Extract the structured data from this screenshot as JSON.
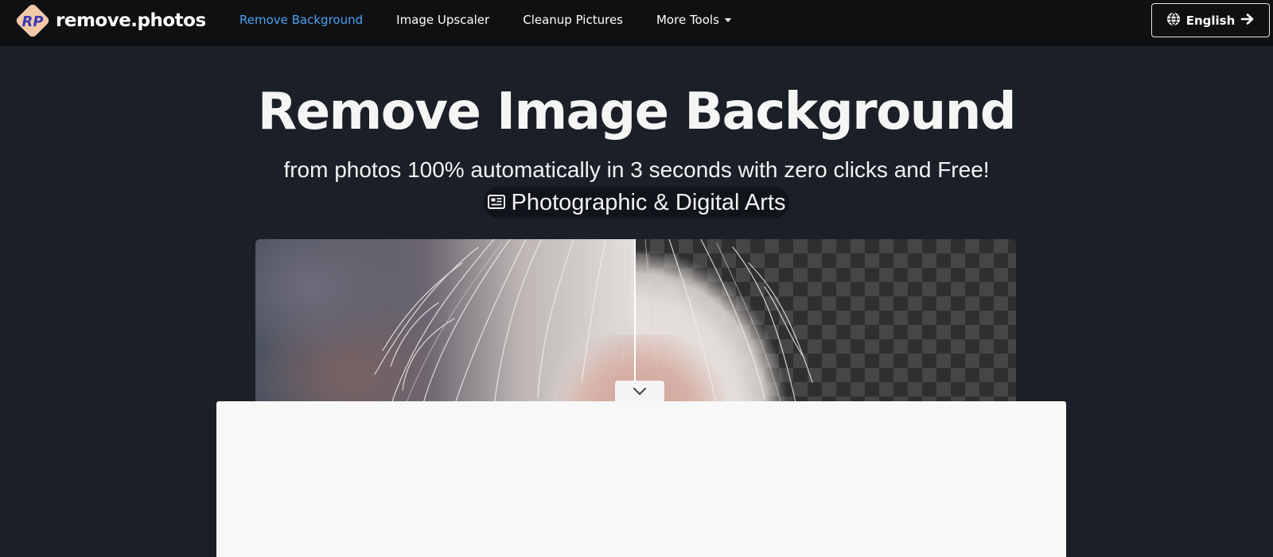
{
  "brand": {
    "logo_initials": "RP",
    "name": "remove.photos"
  },
  "nav": {
    "items": [
      {
        "label": "Remove Background",
        "active": true
      },
      {
        "label": "Image Upscaler",
        "active": false
      },
      {
        "label": "Cleanup Pictures",
        "active": false
      },
      {
        "label": "More Tools",
        "active": false,
        "dropdown": true
      }
    ],
    "language_label": "English"
  },
  "hero": {
    "title": "Remove Image Background",
    "subtitle": "from photos 100% automatically in 3 seconds with zero clicks and Free!",
    "category": "Photographic & Digital Arts"
  },
  "icons": {
    "language": "globe-icon",
    "language_action": "arrow-right-icon",
    "category": "newspaper-icon",
    "handle": "chevron-down-icon"
  },
  "colors": {
    "page_bg": "#1b1f27",
    "navbar_bg": "#0f1012",
    "accent": "#4ea1f2",
    "panel_bg": "#f8f8f8"
  }
}
